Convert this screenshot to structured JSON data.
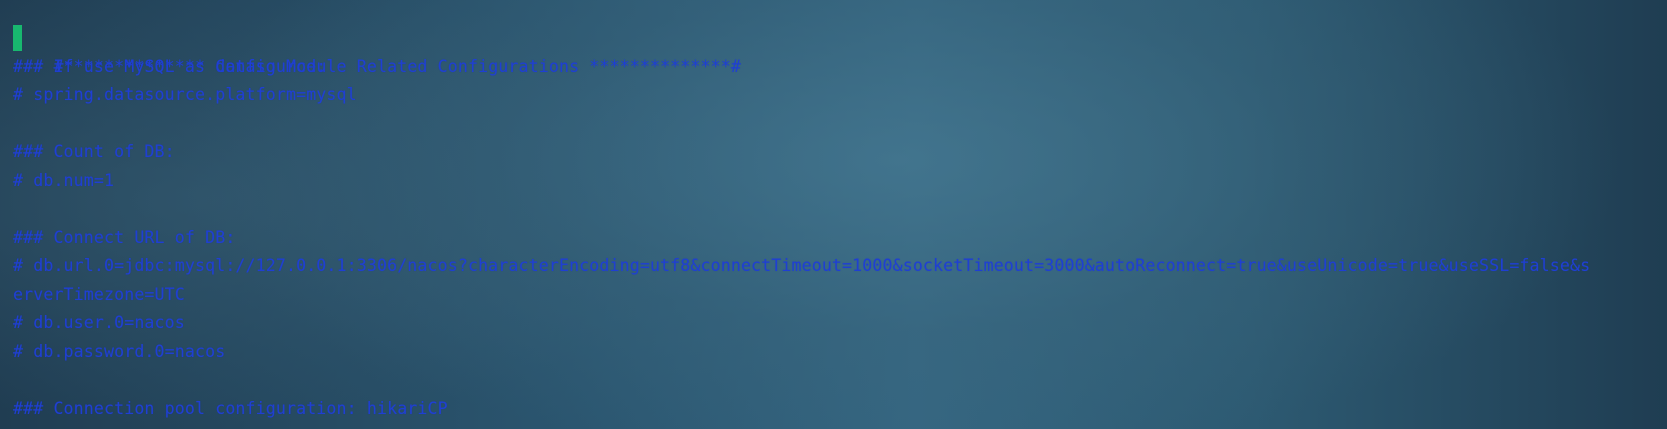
{
  "terminal": {
    "lines": [
      "#************** Config Module Related Configurations **************#",
      "### If use MySQL as datasource:",
      "# spring.datasource.platform=mysql",
      "",
      "### Count of DB:",
      "# db.num=1",
      "",
      "### Connect URL of DB:",
      "# db.url.0=jdbc:mysql://127.0.0.1:3306/nacos?characterEncoding=utf8&connectTimeout=1000&socketTimeout=3000&autoReconnect=true&useUnicode=true&useSSL=false&s",
      "erverTimezone=UTC",
      "# db.user.0=nacos",
      "# db.password.0=nacos",
      "",
      "### Connection pool configuration: hikariCP"
    ],
    "cursor_color": "#18b86f",
    "text_color": "#1f3fd3"
  }
}
